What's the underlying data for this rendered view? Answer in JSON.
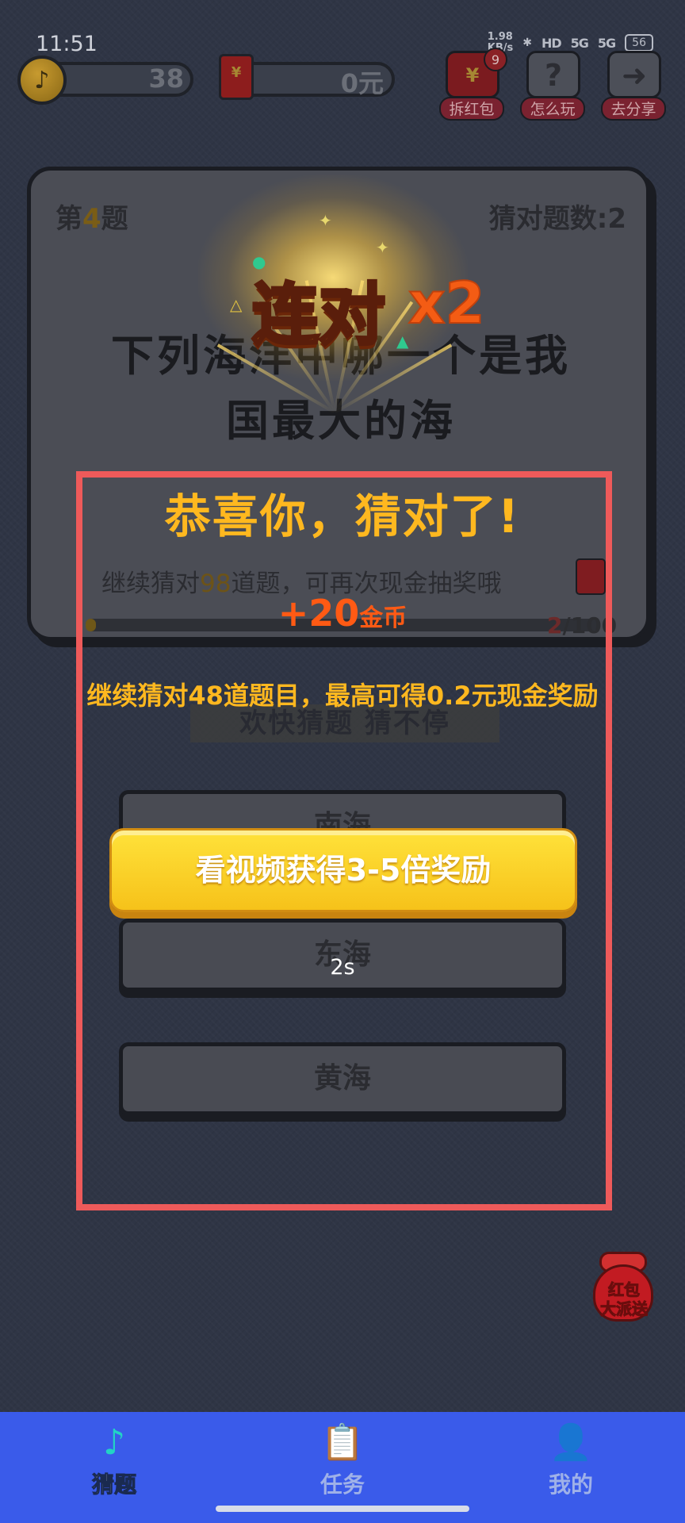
{
  "status_bar": {
    "time": "11:51",
    "net_speed_value": "1.98",
    "net_speed_unit": "KB/s",
    "hd_label": "HD",
    "signal_1": "5G",
    "signal_2": "5G",
    "battery": "56"
  },
  "hud": {
    "coin_count": "38",
    "cash_amount": "0元",
    "badge_count": "9",
    "buttons": [
      {
        "label": "拆红包",
        "icon": "red-envelope-icon"
      },
      {
        "label": "怎么玩",
        "icon": "question-icon",
        "glyph": "?"
      },
      {
        "label": "去分享",
        "icon": "share-arrow-icon",
        "glyph": "➜"
      }
    ]
  },
  "question_card": {
    "prefix": "第",
    "number": "4",
    "suffix": "题",
    "correct_count_label": "猜对题数:2",
    "question_line1": "下列海洋中哪一个是我",
    "question_line2": "国最大的海",
    "progress_hint_prefix": "继续猜对",
    "progress_hint_number": "98",
    "progress_hint_suffix": "道题，可再次现金抽奖哦",
    "progress_current": "2",
    "progress_total": "/100",
    "progress_fraction": 0.02
  },
  "slogan": "欢快猜题 猜不停",
  "answers": [
    {
      "label": "南海"
    },
    {
      "label": "东海"
    },
    {
      "label": "黄海"
    }
  ],
  "popup": {
    "combo_label": "连对",
    "combo_multiplier": "x2",
    "congrats": "恭喜你，猜对了!",
    "reward_amount": "+20",
    "reward_unit": "金币",
    "promo_text": "继续猜对48道题目，最高可得0.2元现金奖励",
    "video_button": "看视频获得3-5倍奖励",
    "countdown": "2s"
  },
  "floating_promo": {
    "line1": "红包",
    "line2": "大派送"
  },
  "bottom_nav": [
    {
      "label": "猜题",
      "icon": "music-note-icon",
      "active": true
    },
    {
      "label": "任务",
      "icon": "clipboard-icon",
      "active": false
    },
    {
      "label": "我的",
      "icon": "person-icon",
      "active": false
    }
  ],
  "colors": {
    "background": "#2f3545",
    "accent_yellow": "#ffb81f",
    "reward_orange": "#ff5a14",
    "nav_blue": "#3a5bea",
    "highlight_red": "#ee5a5a"
  }
}
